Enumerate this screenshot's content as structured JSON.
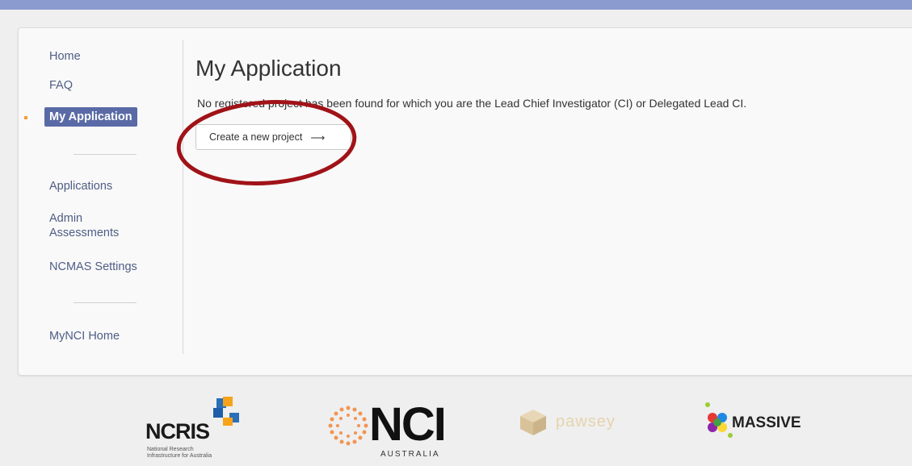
{
  "sidebar": {
    "items": [
      {
        "label": "Home"
      },
      {
        "label": "FAQ"
      },
      {
        "label": "My Application",
        "active": true
      },
      {
        "label": "Applications"
      },
      {
        "label": "Admin Assessments"
      },
      {
        "label": "NCMAS Settings"
      },
      {
        "label": "MyNCI Home"
      }
    ]
  },
  "main": {
    "title": "My Application",
    "message": "No registered project has been found for which you are the Lead Chief Investigator (CI) or Delegated Lead CI.",
    "create_button_label": "Create a new project",
    "create_button_arrow": "⟶"
  },
  "footer": {
    "ncris_name": "NCRIS",
    "ncris_tagline_1": "National Research",
    "ncris_tagline_2": "Infrastructure for Australia",
    "nci_name": "NCI",
    "nci_sub": "AUSTRALIA",
    "pawsey_name": "pawsey",
    "massive_name": "MASSIVE"
  },
  "colors": {
    "topbar": "#8b9bcf",
    "nav_link": "#4f5d85",
    "nav_active_bg": "#5a6aa6",
    "annotation_ellipse": "#a01318"
  }
}
